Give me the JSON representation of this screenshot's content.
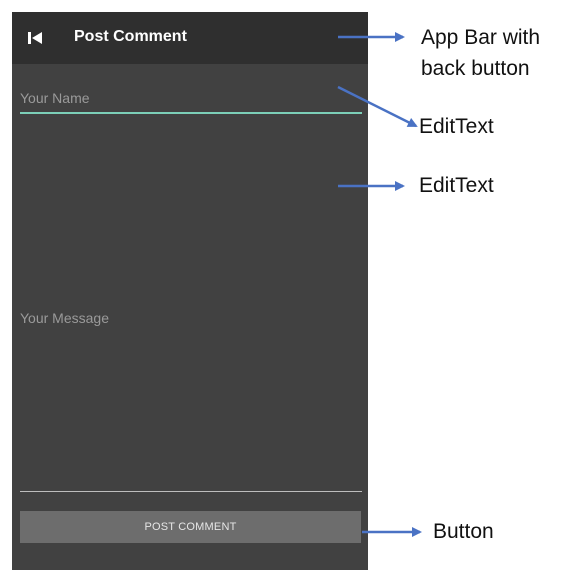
{
  "app_bar": {
    "title": "Post Comment",
    "back_icon": "skip-back-icon"
  },
  "form": {
    "name_placeholder": "Your Name",
    "name_value": "",
    "message_placeholder": "Your Message",
    "message_value": "",
    "submit_label": "POST COMMENT"
  },
  "annotations": {
    "app_bar_line1": "App Bar with",
    "app_bar_line2": "back button",
    "name_edittext": "EditText",
    "message_edittext": "EditText",
    "button": "Button"
  },
  "colors": {
    "screen_bg": "#414141",
    "app_bar_bg": "#2f2f2f",
    "accent_underline": "#7ccfb8",
    "button_bg": "#6d6d6d",
    "arrow": "#4a72c4"
  }
}
